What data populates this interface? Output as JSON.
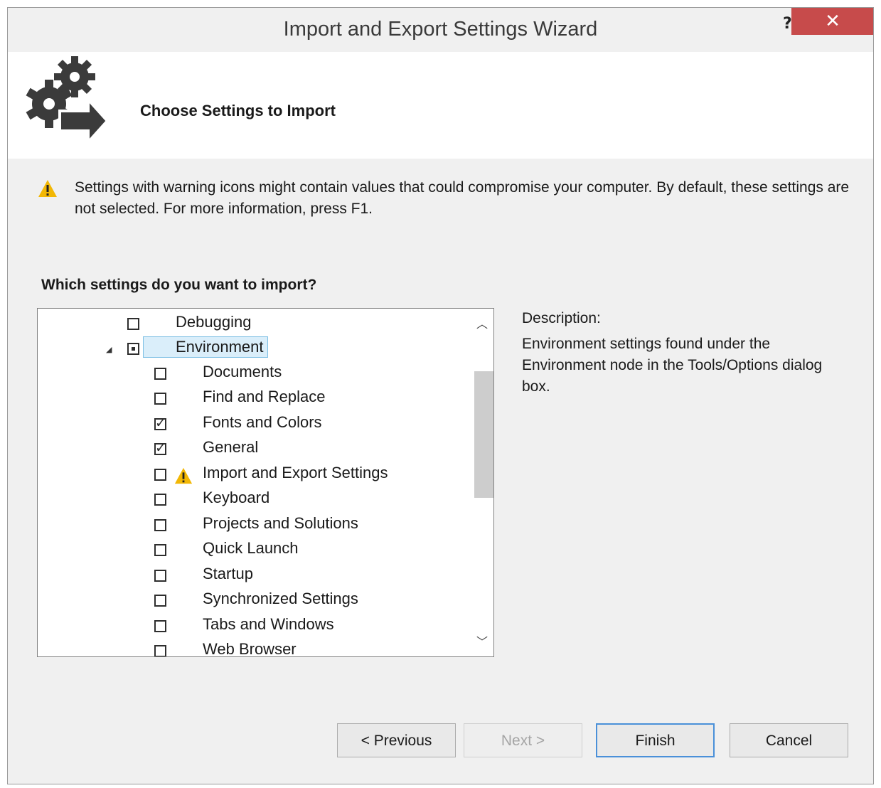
{
  "window": {
    "title": "Import and Export Settings Wizard",
    "help_label": "?",
    "close_label": "✕"
  },
  "header": {
    "title": "Choose Settings to Import"
  },
  "warning": {
    "text": "Settings with warning icons might contain values that could compromise your computer. By default, these settings are not selected. For more information, press F1."
  },
  "question": "Which settings do you want to import?",
  "tree": {
    "items": [
      {
        "label": "Debugging",
        "checked": false
      },
      {
        "label": "Environment",
        "state": "partial",
        "expanded": true,
        "selected": true
      },
      {
        "label": "Documents",
        "checked": false
      },
      {
        "label": "Find and Replace",
        "checked": false
      },
      {
        "label": "Fonts and Colors",
        "checked": true
      },
      {
        "label": "General",
        "checked": true
      },
      {
        "label": "Import and Export Settings",
        "checked": false,
        "warning": true
      },
      {
        "label": "Keyboard",
        "checked": false
      },
      {
        "label": "Projects and Solutions",
        "checked": false
      },
      {
        "label": "Quick Launch",
        "checked": false
      },
      {
        "label": "Startup",
        "checked": false
      },
      {
        "label": "Synchronized Settings",
        "checked": false
      },
      {
        "label": "Tabs and Windows",
        "checked": false
      },
      {
        "label": "Web Browser",
        "checked": false
      }
    ]
  },
  "description": {
    "label": "Description:",
    "text": "Environment settings found under the Environment node in the Tools/Options dialog box."
  },
  "buttons": {
    "previous": "< Previous",
    "next": "Next >",
    "finish": "Finish",
    "cancel": "Cancel"
  },
  "colors": {
    "close_button": "#c74b4b",
    "selection_bg": "#daeefa",
    "selection_border": "#7cbfe4",
    "warning": "#f2b705"
  }
}
